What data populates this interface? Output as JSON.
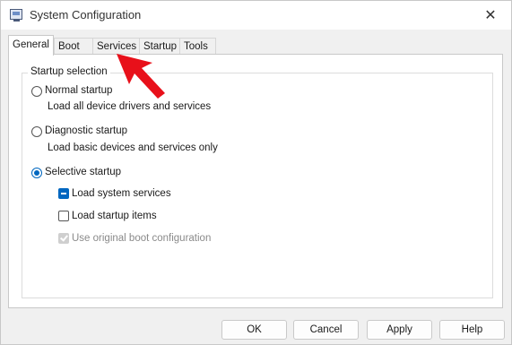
{
  "window": {
    "title": "System Configuration"
  },
  "tabs": [
    {
      "label": "General",
      "active": true
    },
    {
      "label": "Boot"
    },
    {
      "label": "Services"
    },
    {
      "label": "Startup"
    },
    {
      "label": "Tools"
    }
  ],
  "startup": {
    "group_label": "Startup selection",
    "normal": {
      "label": "Normal startup",
      "description": "Load all device drivers and services",
      "checked": false
    },
    "diagnostic": {
      "label": "Diagnostic startup",
      "description": "Load basic devices and services only",
      "checked": false
    },
    "selective": {
      "label": "Selective startup",
      "checked": true,
      "options": [
        {
          "label": "Load system services",
          "state": "indeterminate"
        },
        {
          "label": "Load startup items",
          "state": "unchecked"
        },
        {
          "label": "Use original boot configuration",
          "state": "checked-disabled"
        }
      ]
    }
  },
  "buttons": {
    "ok": "OK",
    "cancel": "Cancel",
    "apply": "Apply",
    "help": "Help"
  },
  "colors": {
    "accent": "#0067c0",
    "annotation": "#e8101a"
  },
  "icons": {
    "app": "system-configuration-icon",
    "close": "close-icon",
    "annotation": "red-arrow-annotation"
  }
}
